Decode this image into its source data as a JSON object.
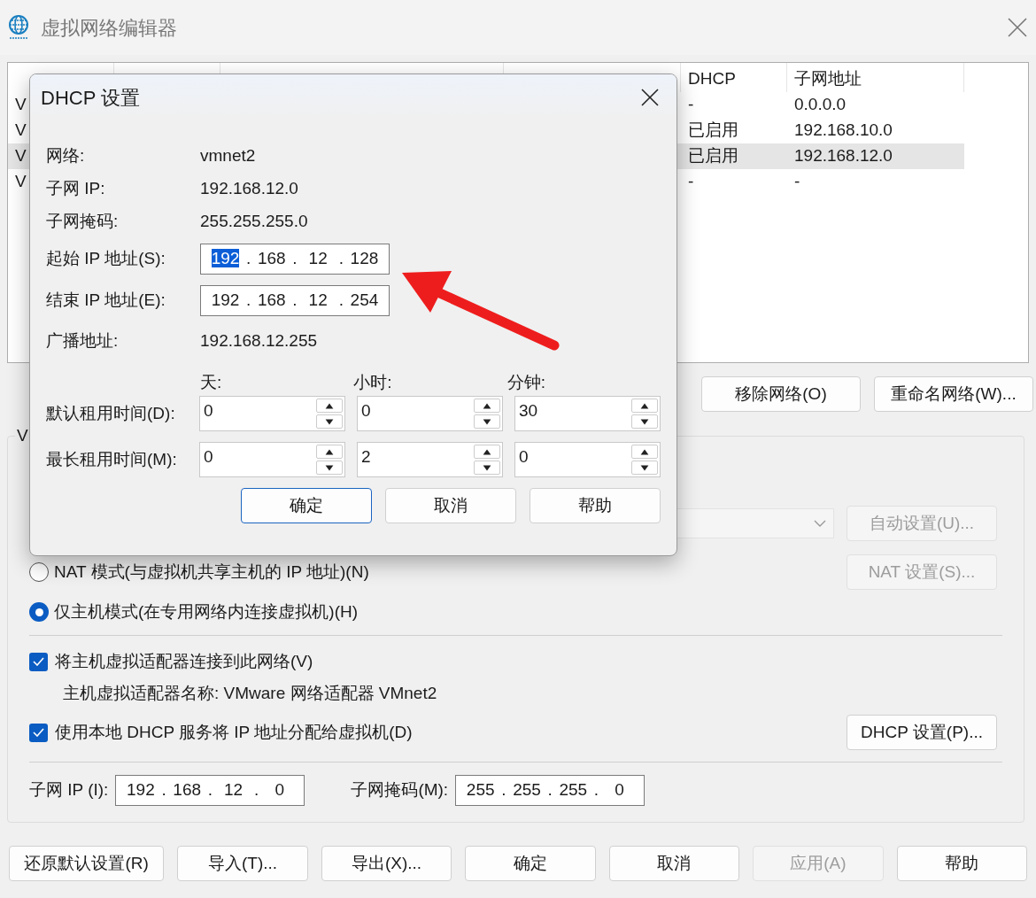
{
  "window": {
    "title": "虚拟网络编辑器"
  },
  "table": {
    "visible_columns": [
      "DHCP",
      "子网地址"
    ],
    "rows": [
      {
        "name": "V",
        "dhcp": "-",
        "subnet": "0.0.0.0",
        "selected": false
      },
      {
        "name": "V",
        "dhcp": "已启用",
        "subnet": "192.168.10.0",
        "selected": false
      },
      {
        "name": "V",
        "dhcp": "已启用",
        "subnet": "192.168.12.0",
        "selected": true
      },
      {
        "name": "V",
        "dhcp": "-",
        "subnet": "-",
        "selected": false
      }
    ]
  },
  "network_buttons": [
    "移除网络(O)",
    "重命名网络(W)..."
  ],
  "group": {
    "title": "V",
    "dropdown": {
      "disabled": true
    },
    "auto_button": {
      "label": "自动设置(U)...",
      "disabled": true
    },
    "modes": [
      {
        "label": "NAT 模式(与虚拟机共享主机的 IP 地址)(N)",
        "selected": false,
        "button": {
          "label": "NAT 设置(S)...",
          "disabled": true
        }
      },
      {
        "label": "仅主机模式(在专用网络内连接虚拟机)(H)",
        "selected": true
      }
    ],
    "connect_adapter": {
      "label": "将主机虚拟适配器连接到此网络(V)",
      "checked": true
    },
    "adapter_name": "主机虚拟适配器名称: VMware 网络适配器 VMnet2",
    "use_dhcp": {
      "label": "使用本地 DHCP 服务将 IP 地址分配给虚拟机(D)",
      "checked": true
    },
    "dhcp_button": "DHCP 设置(P)...",
    "subnet_ip": {
      "label": "子网 IP (I):",
      "separator": ".",
      "octets": [
        {
          "text": "192",
          "selected": false
        },
        {
          "text": "168",
          "selected": false
        },
        {
          "text": "12",
          "selected": false
        },
        {
          "text": "0",
          "selected": false
        }
      ]
    },
    "subnet_mask": {
      "label": "子网掩码(M):",
      "separator": ".",
      "octets": [
        {
          "text": "255",
          "selected": false
        },
        {
          "text": "255",
          "selected": false
        },
        {
          "text": "255",
          "selected": false
        },
        {
          "text": "0",
          "selected": false
        }
      ]
    }
  },
  "footer_buttons": [
    {
      "label": "还原默认设置(R)",
      "disabled": false
    },
    {
      "label": "导入(T)...",
      "disabled": false
    },
    {
      "label": "导出(X)...",
      "disabled": false
    },
    {
      "label": "确定",
      "disabled": false
    },
    {
      "label": "取消",
      "disabled": false
    },
    {
      "label": "应用(A)",
      "disabled": true
    },
    {
      "label": "帮助",
      "disabled": false
    }
  ],
  "dialog": {
    "title": "DHCP 设置",
    "info": [
      {
        "label": "网络:",
        "value": "vmnet2"
      },
      {
        "label": "子网 IP:",
        "value": "192.168.12.0"
      },
      {
        "label": "子网掩码:",
        "value": "255.255.255.0"
      }
    ],
    "start_ip": {
      "label": "起始 IP 地址(S):",
      "separator": ".",
      "octets": [
        {
          "text": "192",
          "selected": true
        },
        {
          "text": "168",
          "selected": false
        },
        {
          "text": "12",
          "selected": false
        },
        {
          "text": "128",
          "selected": false
        }
      ]
    },
    "end_ip": {
      "label": "结束 IP 地址(E):",
      "separator": ".",
      "octets": [
        {
          "text": "192",
          "selected": false
        },
        {
          "text": "168",
          "selected": false
        },
        {
          "text": "12",
          "selected": false
        },
        {
          "text": "254",
          "selected": false
        }
      ]
    },
    "broadcast": {
      "label": "广播地址:",
      "value": "192.168.12.255"
    },
    "lease": {
      "columns": [
        "天:",
        "小时:",
        "分钟:"
      ],
      "rows": [
        {
          "label": "默认租用时间(D):",
          "values": [
            "0",
            "0",
            "30"
          ]
        },
        {
          "label": "最长租用时间(M):",
          "values": [
            "0",
            "2",
            "0"
          ]
        }
      ]
    },
    "buttons": [
      {
        "label": "确定",
        "default": true
      },
      {
        "label": "取消",
        "default": false
      },
      {
        "label": "帮助",
        "default": false
      }
    ]
  }
}
